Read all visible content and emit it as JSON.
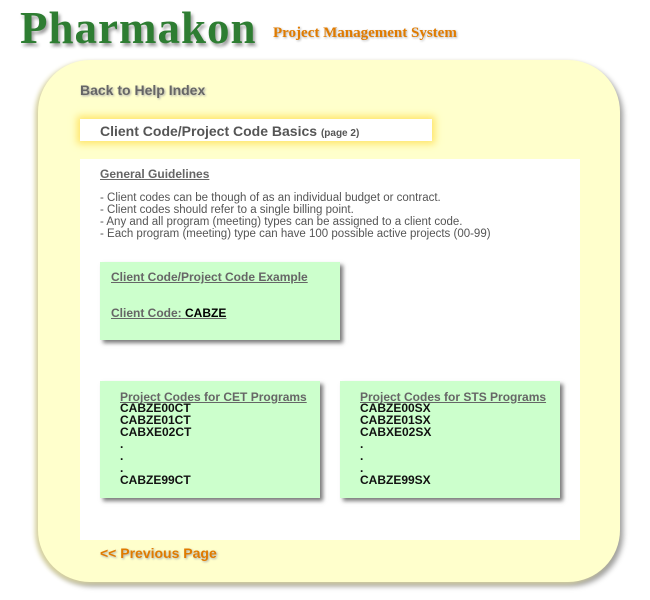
{
  "header": {
    "logo": "Pharmakon",
    "tagline": "Project Management System"
  },
  "nav": {
    "back_link": "Back to Help Index",
    "previous_link": "<< Previous Page"
  },
  "page": {
    "title": "Client Code/Project Code Basics",
    "subtitle": "(page 2)"
  },
  "guidelines": {
    "heading": "General Guidelines",
    "items": [
      "- Client codes can be though of as an individual budget or contract.",
      "- Client codes should refer to a single billing point.",
      "- Any and all program (meeting) types can be assigned to a client code.",
      "- Each program (meeting) type can have 100 possible active projects (00-99)"
    ]
  },
  "example": {
    "title": "Client Code/Project Code Example",
    "client_code_label": "Client Code:",
    "client_code_value": "CABZE"
  },
  "cet": {
    "title": "Project Codes for CET Programs",
    "codes": [
      "CABZE00CT",
      "CABZE01CT",
      "CABXE02CT",
      ".",
      ".",
      ".",
      "CABZE99CT"
    ]
  },
  "sts": {
    "title": "Project Codes for STS Programs",
    "codes": [
      "CABZE00SX",
      "CABZE01SX",
      "CABXE02SX",
      ".",
      ".",
      ".",
      "CABZE99SX"
    ]
  },
  "colors": {
    "logo": "#2e7d32",
    "accent_orange": "#e07b00",
    "panel_background": "#ffffcc",
    "box_background": "#ccffcc",
    "title_glow": "#ffe66b"
  }
}
